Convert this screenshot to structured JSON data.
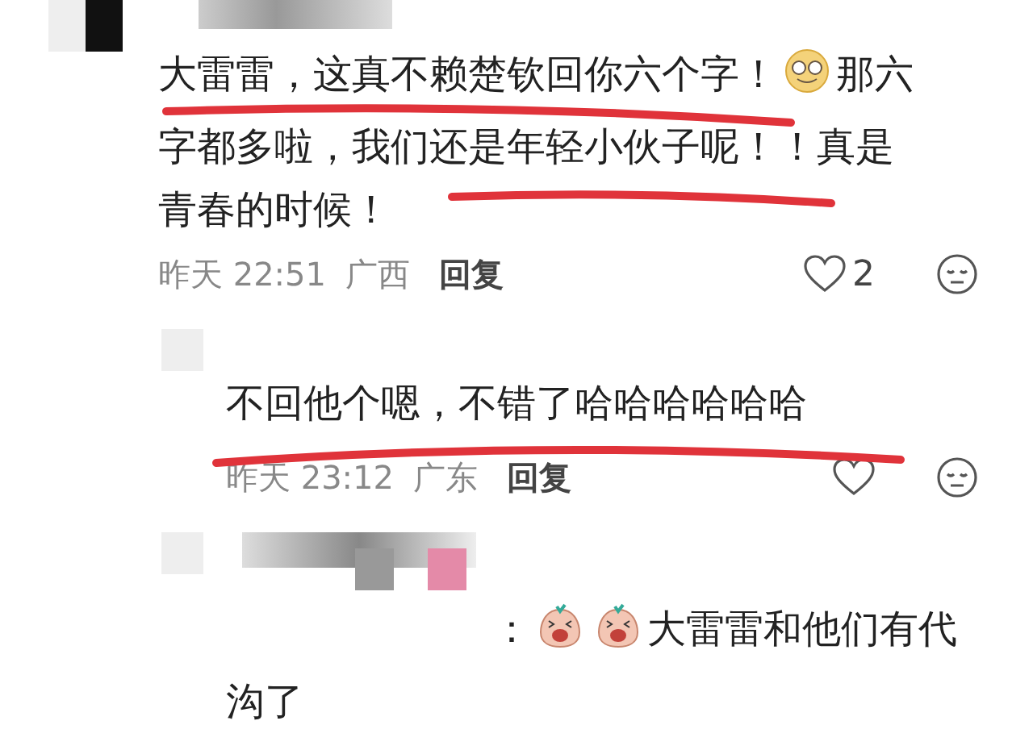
{
  "comments": [
    {
      "kind": "top",
      "text_before": "大雷雷，这真不赖楚钦回你六个字！",
      "text_after": "那六",
      "more_lines": [
        "字都多啦，我们还是年轻小伙子呢！！真是",
        "青春的时候！"
      ],
      "time": "昨天 22:51",
      "region": "广西",
      "reply": "回复",
      "likes": "2",
      "liked": false
    },
    {
      "kind": "reply",
      "text_before": "不回他个嗯，不错了哈哈哈哈哈哈",
      "time": "昨天 23:12",
      "region": "广东",
      "reply": "回复",
      "liked": false
    },
    {
      "kind": "reply_to",
      "separator": "：",
      "text_after": "大雷雷和他们有代",
      "more_lines": [
        "沟了"
      ]
    }
  ]
}
